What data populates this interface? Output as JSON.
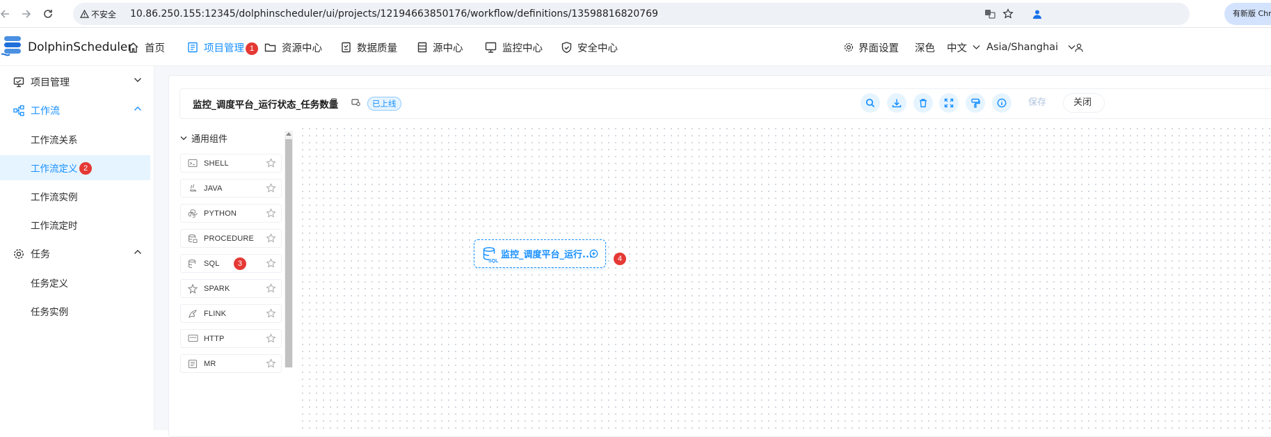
{
  "browser": {
    "security_label": "不安全",
    "url": "10.86.250.155:12345/dolphinscheduler/ui/projects/12194663850176/workflow/definitions/13598816820769",
    "update_button": "有新版 Chrome"
  },
  "app": {
    "name": "DolphinScheduler"
  },
  "topnav": {
    "items": [
      {
        "label": "首页",
        "icon": "home-icon"
      },
      {
        "label": "项目管理",
        "icon": "project-icon",
        "active": true,
        "badge": "1"
      },
      {
        "label": "资源中心",
        "icon": "folder-icon"
      },
      {
        "label": "数据质量",
        "icon": "quality-icon"
      },
      {
        "label": "源中心",
        "icon": "datasource-icon"
      },
      {
        "label": "监控中心",
        "icon": "monitor-icon"
      },
      {
        "label": "安全中心",
        "icon": "shield-icon"
      }
    ],
    "settings": "界面设置",
    "theme": "深色",
    "language": "中文",
    "timezone": "Asia/Shanghai"
  },
  "sidebar": {
    "groups": [
      {
        "label": "项目管理",
        "icon": "project-icon",
        "open": false
      },
      {
        "label": "工作流",
        "icon": "workflow-icon",
        "open": true,
        "items": [
          {
            "label": "工作流关系"
          },
          {
            "label": "工作流定义",
            "active": true,
            "badge": "2"
          },
          {
            "label": "工作流实例"
          },
          {
            "label": "工作流定时"
          }
        ]
      },
      {
        "label": "任务",
        "icon": "gear-icon",
        "open": true,
        "items": [
          {
            "label": "任务定义"
          },
          {
            "label": "任务实例"
          }
        ]
      }
    ]
  },
  "workflow": {
    "title": "监控_调度平台_运行状态_任务数量",
    "status": "已上线",
    "save_label": "保存",
    "close_label": "关闭"
  },
  "toolbar_icons": [
    "search-icon",
    "download-icon",
    "delete-icon",
    "fullscreen-icon",
    "format-icon",
    "info-icon"
  ],
  "palette": {
    "title": "通用组件",
    "items": [
      {
        "label": "SHELL",
        "icon": "terminal-icon"
      },
      {
        "label": "JAVA",
        "icon": "java-icon"
      },
      {
        "label": "PYTHON",
        "icon": "python-icon"
      },
      {
        "label": "PROCEDURE",
        "icon": "procedure-icon"
      },
      {
        "label": "SQL",
        "icon": "database-icon",
        "badge": "3"
      },
      {
        "label": "SPARK",
        "icon": "spark-icon"
      },
      {
        "label": "FLINK",
        "icon": "flink-icon"
      },
      {
        "label": "HTTP",
        "icon": "http-icon"
      },
      {
        "label": "MR",
        "icon": "mr-icon"
      }
    ]
  },
  "canvas": {
    "node": {
      "label": "监控_调度平台_运行...",
      "type": "SQL",
      "badge": "4"
    }
  },
  "colors": {
    "accent": "#1890ff",
    "badge": "#e53935"
  }
}
